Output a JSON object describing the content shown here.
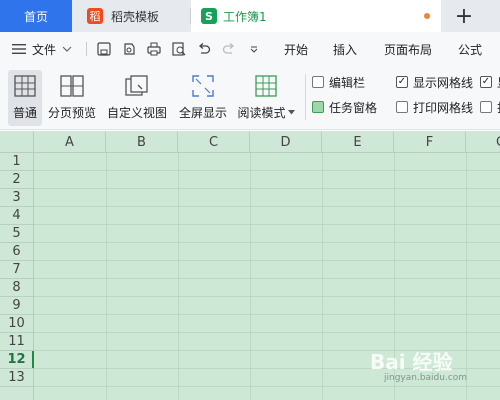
{
  "tabs": {
    "home": "首页",
    "daoke": "稻壳模板",
    "daoke_icon": "稻",
    "book": "工作簿1",
    "book_icon": "S",
    "new_tab": "+"
  },
  "menu": {
    "file": "文件",
    "items": [
      "开始",
      "插入",
      "页面布局",
      "公式"
    ]
  },
  "ribbon": {
    "views": [
      "普通",
      "分页预览",
      "自定义视图",
      "全屏显示",
      "阅读模式"
    ],
    "checks": [
      {
        "label": "编辑栏",
        "checked": false
      },
      {
        "label": "显示网格线",
        "checked": true
      },
      {
        "label": "显",
        "checked": true
      },
      {
        "label": "任务窗格",
        "checked": true
      },
      {
        "label": "打印网格线",
        "checked": false
      },
      {
        "label": "打",
        "checked": false
      }
    ]
  },
  "sheet": {
    "columns": [
      "A",
      "B",
      "C",
      "D",
      "E",
      "F",
      "G"
    ],
    "rows": [
      "1",
      "2",
      "3",
      "4",
      "5",
      "6",
      "7",
      "8",
      "9",
      "10",
      "11",
      "12",
      "13"
    ],
    "active_row": "12"
  },
  "watermark": {
    "main": "Bai 经验",
    "sub": "jingyan.baidu.com"
  },
  "colors": {
    "home_tab": "#2f74ea",
    "accent_green": "#18a058",
    "grid_bg": "#cde9d5"
  }
}
